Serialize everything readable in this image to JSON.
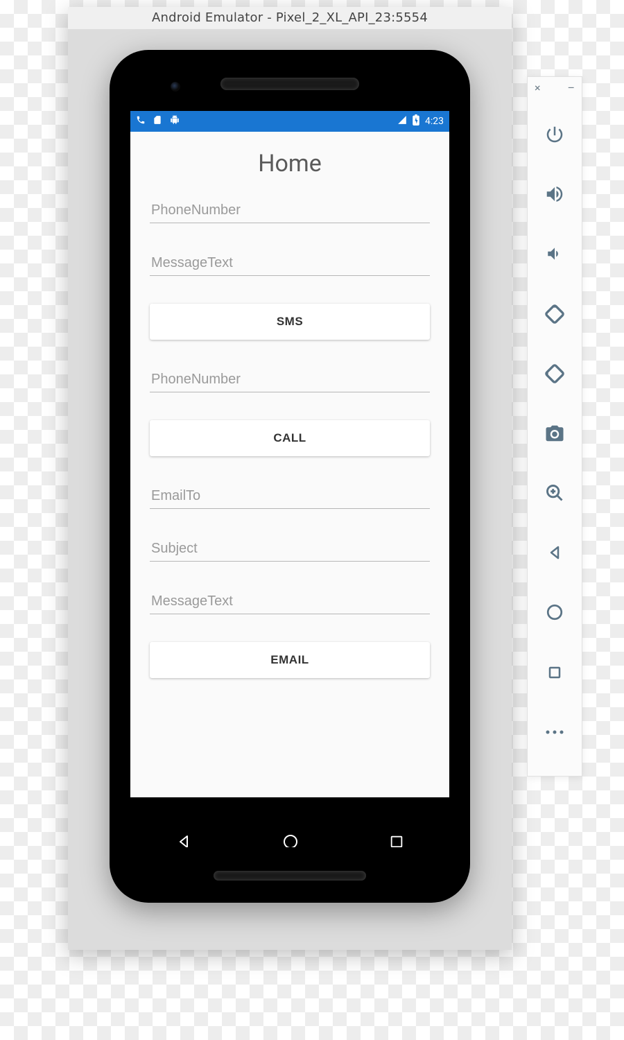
{
  "emulator": {
    "title": "Android Emulator - Pixel_2_XL_API_23:5554"
  },
  "statusbar": {
    "time": "4:23"
  },
  "app": {
    "title": "Home",
    "sms": {
      "phone_placeholder": "PhoneNumber",
      "message_placeholder": "MessageText",
      "button_label": "SMS"
    },
    "call": {
      "phone_placeholder": "PhoneNumber",
      "button_label": "CALL"
    },
    "email": {
      "to_placeholder": "EmailTo",
      "subject_placeholder": "Subject",
      "message_placeholder": "MessageText",
      "button_label": "EMAIL"
    }
  },
  "side_toolbar": {
    "close": "×",
    "minimize": "–"
  }
}
